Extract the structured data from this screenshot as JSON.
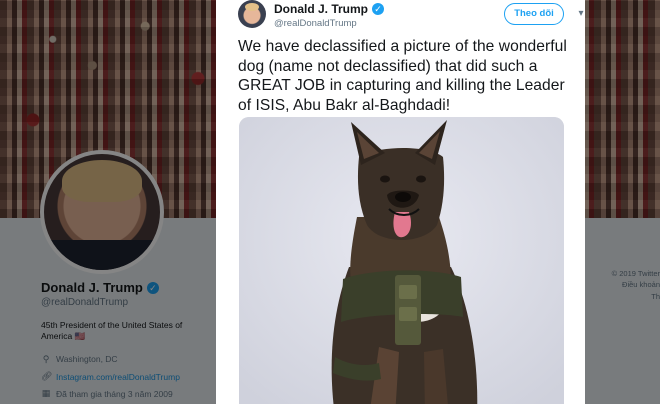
{
  "profile": {
    "name": "Donald J. Trump",
    "handle": "@realDonaldTrump",
    "bio": "45th President of the United States of America",
    "flag": "🇺🇸",
    "location": "Washington, DC",
    "website": "Instagram.com/realDonaldTrump",
    "joined": "Đã tham gia tháng 3 năm 2009"
  },
  "footer": {
    "copyright": "© 2019 Twitter",
    "link": "Điều khoản",
    "more": "Th"
  },
  "tweet": {
    "author_name": "Donald J. Trump",
    "author_handle": "@realDonaldTrump",
    "follow_label": "Theo dõi",
    "text": "We have declassified a picture of the wonderful dog (name not declassified) that did such a GREAT JOB in capturing and killing the Leader of ISIS, Abu Bakr al-Baghdadi!"
  },
  "icons": {
    "verified": "verified-badge-icon",
    "location": "location-pin-icon",
    "link": "link-icon",
    "calendar": "calendar-icon",
    "caret": "chevron-down-icon"
  },
  "colors": {
    "accent": "#1da1f2",
    "link": "#1b95e0",
    "muted": "#657786",
    "text": "#14171a"
  }
}
